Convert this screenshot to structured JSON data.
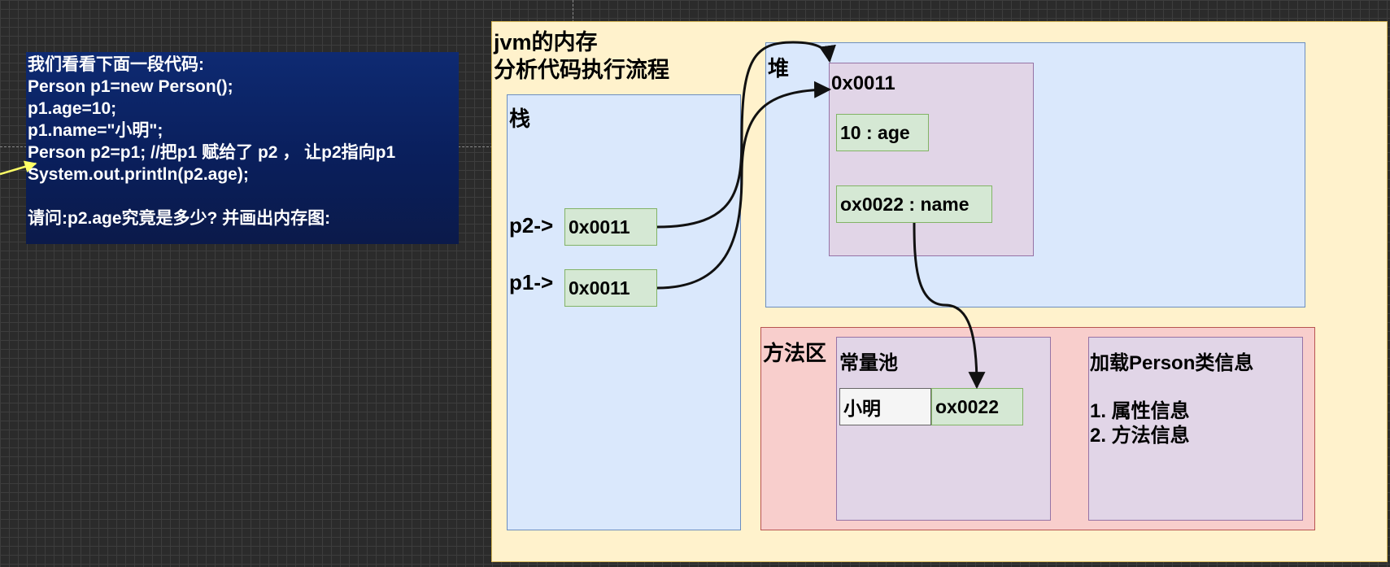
{
  "code_panel": {
    "lines": [
      "我们看看下面一段代码:",
      "Person p1=new Person();",
      "p1.age=10;",
      "p1.name=\"小明\";",
      "Person p2=p1; //把p1 赋给了 p2 ， 让p2指向p1",
      "System.out.println(p2.age);",
      "",
      "请问:p2.age究竟是多少? 并画出内存图:"
    ]
  },
  "diagram": {
    "title_line1": "jvm的内存",
    "title_line2": "分析代码执行流程",
    "stack": {
      "label": "栈",
      "p2_label": "p2->",
      "p2_value": "0x0011",
      "p1_label": "p1->",
      "p1_value": "0x0011"
    },
    "heap": {
      "label": "堆",
      "object_address": "0x0011",
      "field_age": "10 : age",
      "field_name": "ox0022 : name"
    },
    "method_area": {
      "label": "方法区",
      "constant_pool": {
        "label": "常量池",
        "string_value": "小明",
        "string_address": "ox0022"
      },
      "class_info": {
        "label": "加载Person类信息",
        "item1": "1. 属性信息",
        "item2": "2. 方法信息"
      }
    }
  },
  "colors": {
    "background": "#2b2b2b",
    "code_panel": "#0e2a72",
    "frame_fill": "#fff2cc",
    "stack_heap_fill": "#dae8fc",
    "object_fill": "#e1d5e7",
    "method_area_fill": "#f8cecc",
    "cell_fill": "#d5e8d4",
    "pointer_arrow": "#ffff66"
  }
}
